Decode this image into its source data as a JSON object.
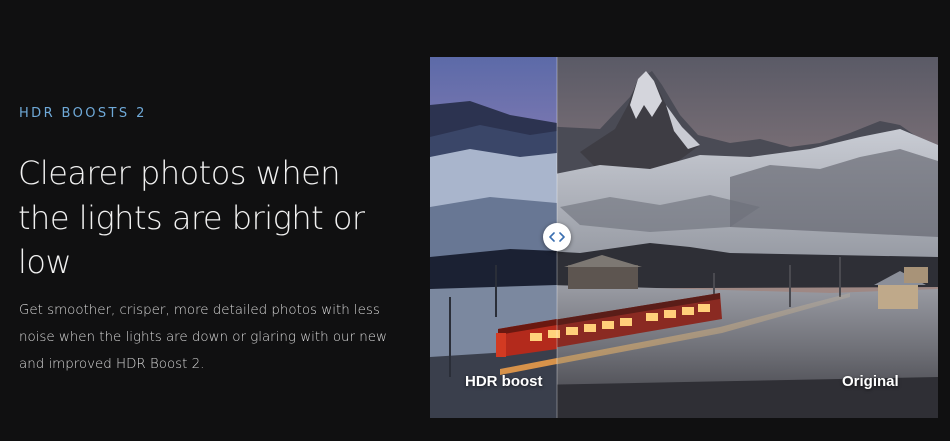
{
  "section": {
    "eyebrow": "HDR BOOSTS 2",
    "headline": "Clearer photos when the lights are bright or low",
    "body": "Get smoother, crisper, more detailed photos with less noise when the lights are down or glaring with our new and improved HDR Boost 2."
  },
  "comparison": {
    "left_label": "HDR boost",
    "right_label": "Original",
    "divider_position_percent": 25,
    "image_description_icon": "mountain-train-photo"
  },
  "colors": {
    "background": "#101011",
    "accent": "#6fa9d8",
    "headline": "#f1f1f1",
    "body": "#d9d9d9"
  }
}
